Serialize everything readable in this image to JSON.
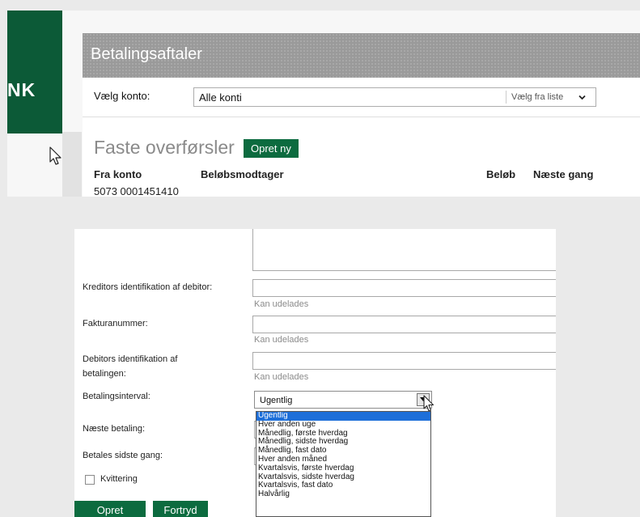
{
  "brand": {
    "text": "NK"
  },
  "betalingsaftaler": {
    "title": "Betalingsaftaler",
    "konto_label": "Vælg konto:",
    "konto_value": "Alle konti",
    "konto_hint": "Vælg fra liste",
    "faste_title": "Faste overførsler",
    "opret_ny_label": "Opret ny",
    "columns": [
      "Fra konto",
      "Beløbsmodtager",
      "Beløb",
      "Næste gang"
    ],
    "first_row_account": "5073 0001451410"
  },
  "form": {
    "kreditor_label": "Kreditors identifikation af debitor:",
    "kreditor_hint": "Kan udelades",
    "faktura_label": "Fakturanummer:",
    "faktura_hint": "Kan udelades",
    "debitor_label_line1": "Debitors identifikation af",
    "debitor_label_line2": "betalingen:",
    "debitor_hint": "Kan udelades",
    "interval_label": "Betalingsinterval:",
    "interval_value": "Ugentlig",
    "interval_options": [
      "Ugentlig",
      "Hver anden uge",
      "Månedlig, første hverdag",
      "Månedlig, sidste hverdag",
      "Månedlig, fast dato",
      "Hver anden måned",
      "Kvartalsvis, første hverdag",
      "Kvartalsvis, sidste hverdag",
      "Kvartalsvis, fast dato",
      "Halvårlig"
    ],
    "naeste_label": "Næste betaling:",
    "sidste_label": "Betales sidste gang:",
    "kvittering_label": "Kvittering",
    "opret_label": "Opret",
    "fortryd_label": "Fortryd"
  },
  "colors": {
    "brand_green": "#0c5a37",
    "button_green": "#0c6b3f",
    "selection_blue": "#1e6fd9",
    "header_gray": "#9a9a9a"
  }
}
